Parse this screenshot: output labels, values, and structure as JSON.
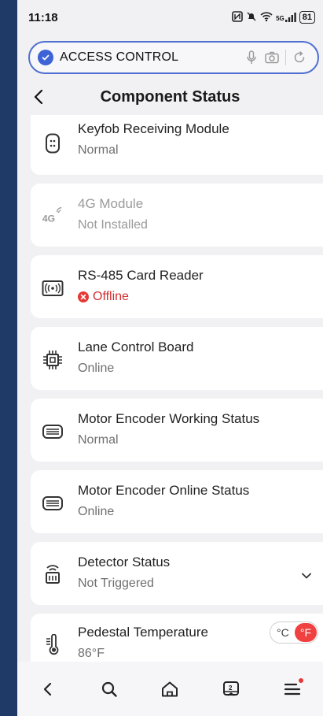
{
  "status_bar": {
    "time": "11:18",
    "network": "5G",
    "battery": "81"
  },
  "address_bar": {
    "title": "ACCESS CONTROL"
  },
  "header": {
    "title": "Component Status"
  },
  "components": [
    {
      "name": "Keyfob Receiving Module",
      "status": "Normal",
      "icon": "keyfob-icon"
    },
    {
      "name": "4G Module",
      "status": "Not Installed",
      "icon": "4g-icon",
      "disabled": true
    },
    {
      "name": "RS-485 Card Reader",
      "status": "Offline",
      "icon": "card-reader-icon",
      "error": true
    },
    {
      "name": "Lane Control Board",
      "status": "Online",
      "icon": "chip-icon"
    },
    {
      "name": "Motor Encoder Working Status",
      "status": "Normal",
      "icon": "motor-encoder-icon"
    },
    {
      "name": "Motor Encoder Online Status",
      "status": "Online",
      "icon": "motor-encoder-icon"
    },
    {
      "name": "Detector Status",
      "status": "Not Triggered",
      "icon": "detector-icon",
      "expandable": true
    },
    {
      "name": "Pedestal Temperature",
      "status": "86°F",
      "icon": "thermometer-icon"
    }
  ],
  "temperature_toggle": {
    "celsius_label": "°C",
    "fahrenheit_label": "°F",
    "selected": "°F"
  },
  "colors": {
    "accent": "#3d63d6",
    "error": "#e53935",
    "toggle_active": "#f04040"
  }
}
